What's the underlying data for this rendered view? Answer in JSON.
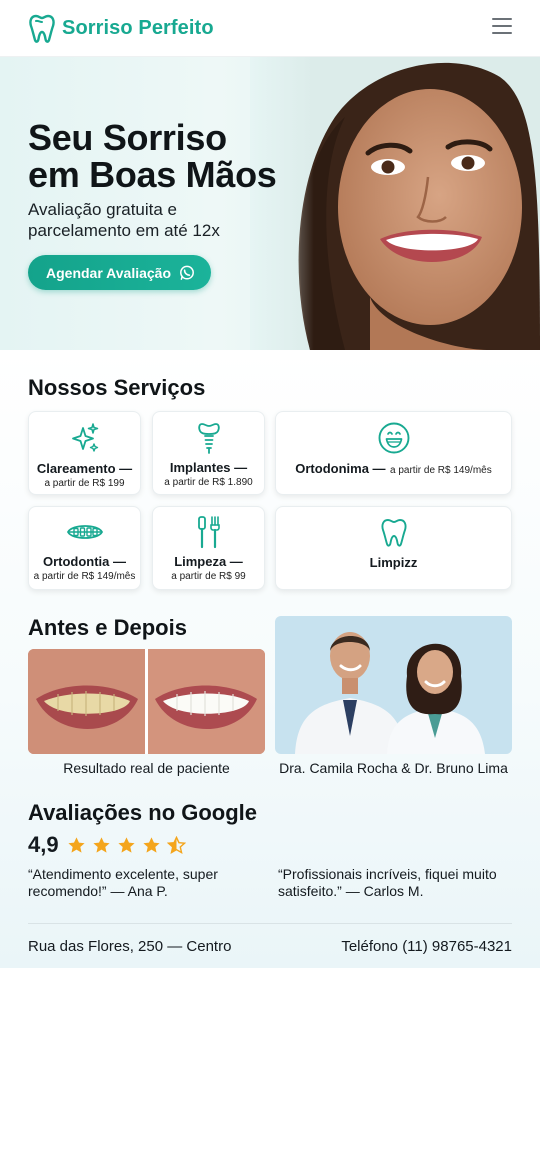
{
  "header": {
    "brand": "Sorriso Perfeito",
    "logo_icon": "tooth-icon",
    "menu_icon": "hamburger-menu-icon",
    "brand_color": "#18a991"
  },
  "hero": {
    "title_line1": "Seu Sorriso",
    "title_line2": "em Boas Mãos",
    "subtitle_line1": "Avaliação gratuita e",
    "subtitle_line2": "parcelamento em até 12x",
    "cta_label": "Agendar Avaliação",
    "cta_icon": "whatsapp-icon"
  },
  "services": {
    "title": "Nossos Serviços",
    "items": [
      {
        "name": "Clareamento —",
        "price": "a partir de R$ 199",
        "icon": "sparkle-icon"
      },
      {
        "name": "Implantes —",
        "price": "a partir de R$ 1.890",
        "icon": "implant-icon"
      },
      {
        "name": "Ortodonima —",
        "price": "a partir de R$ 149/mês",
        "icon": "smile-icon"
      },
      {
        "name": "Ortodontia —",
        "price": "a partir de R$ 149/mês",
        "icon": "braces-icon"
      },
      {
        "name": "Limpeza —",
        "price": "a partir de R$ 99",
        "icon": "toothbrush-icon"
      },
      {
        "name": "Limpizz",
        "price": "",
        "icon": "tooth-icon"
      }
    ]
  },
  "before_after": {
    "title": "Antes e Depois",
    "caption": "Resultado real de paciente",
    "team_caption": "Dra. Camila Rocha & Dr. Bruno Lima"
  },
  "reviews": {
    "title": "Avaliações no Google",
    "rating": "4,9",
    "stars": 4.5,
    "star_color": "#f4a51c",
    "items": [
      {
        "line1": "“Atendimento excelente, super",
        "line2": "recomendo!” — Ana P."
      },
      {
        "line1": "“Profissionais incríveis, fiquei muito",
        "line2": "satisfeito.” — Carlos M."
      }
    ]
  },
  "footer": {
    "address": "Rua das Flores, 250 — Centro",
    "phone": "Teléfono (11) 98765-4321"
  }
}
